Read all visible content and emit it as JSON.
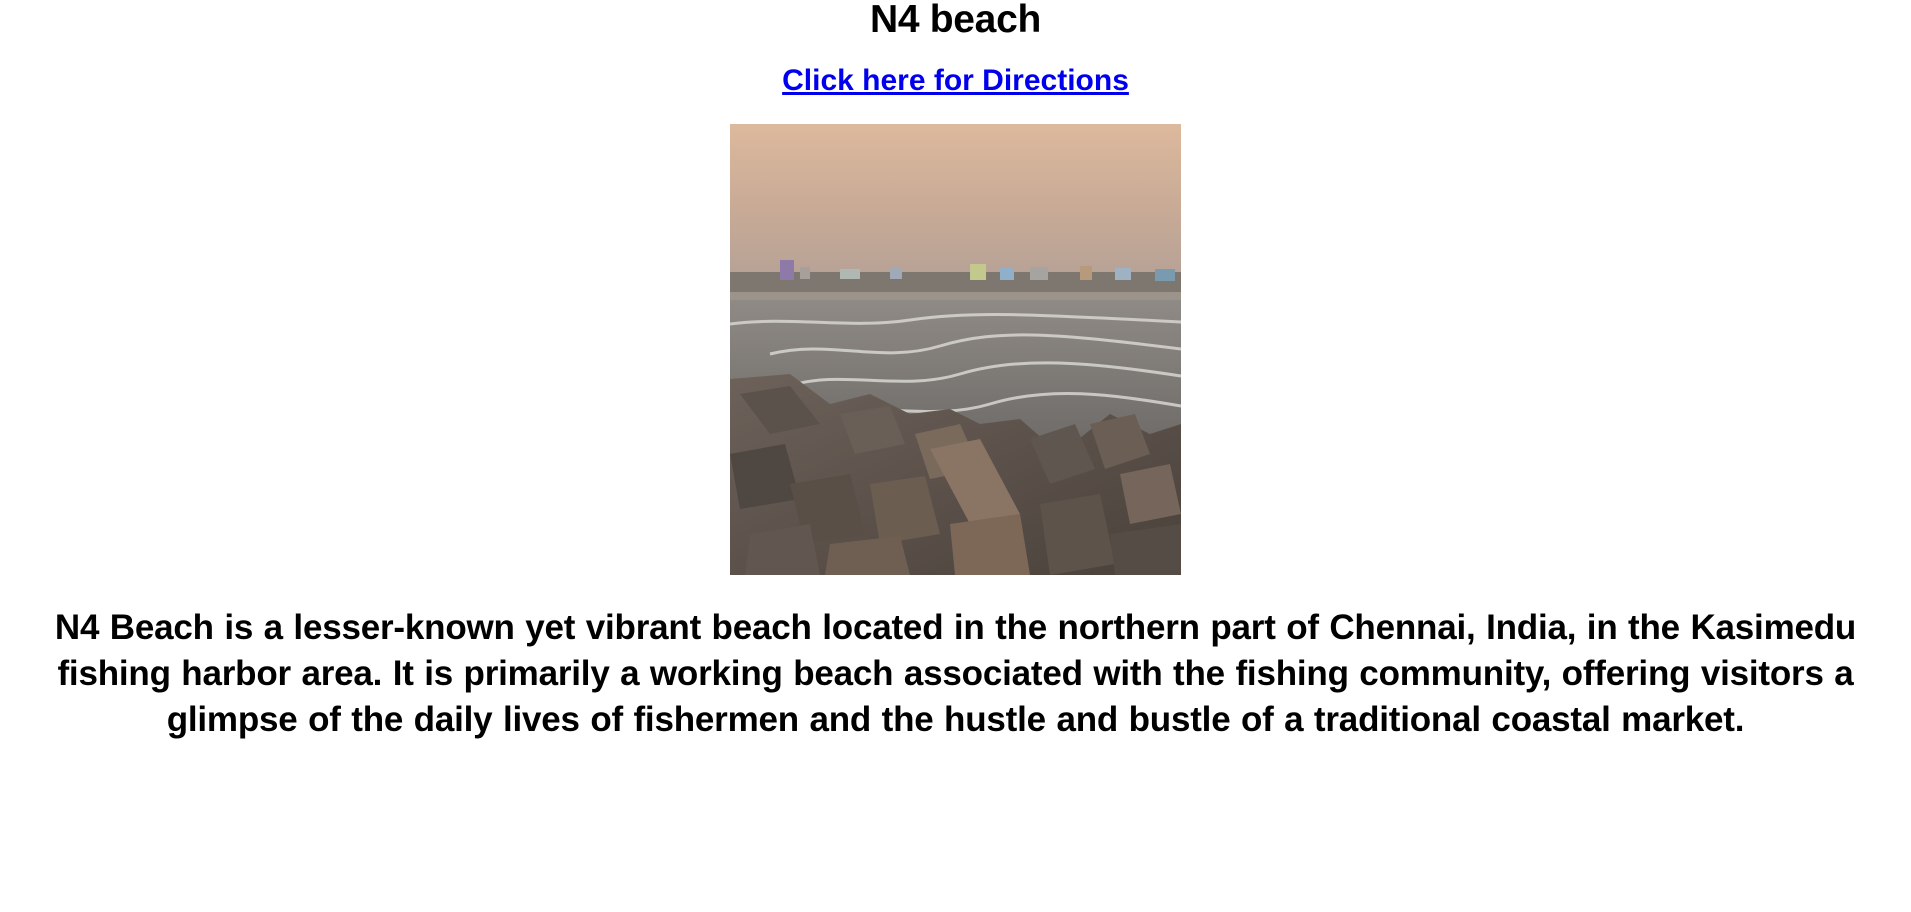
{
  "page": {
    "title": "N4 beach",
    "directions_link_label": "Click here for Directions",
    "description": "N4 Beach is a lesser-known yet vibrant beach located in the northern part of Chennai, India, in the Kasimedu fishing harbor area. It is primarily a working beach associated with the fishing community, offering visitors a glimpse of the daily lives of fishermen and the hustle and bustle of a traditional coastal market."
  },
  "colors": {
    "link": "#0000ee",
    "text": "#000000",
    "background": "#ffffff"
  }
}
